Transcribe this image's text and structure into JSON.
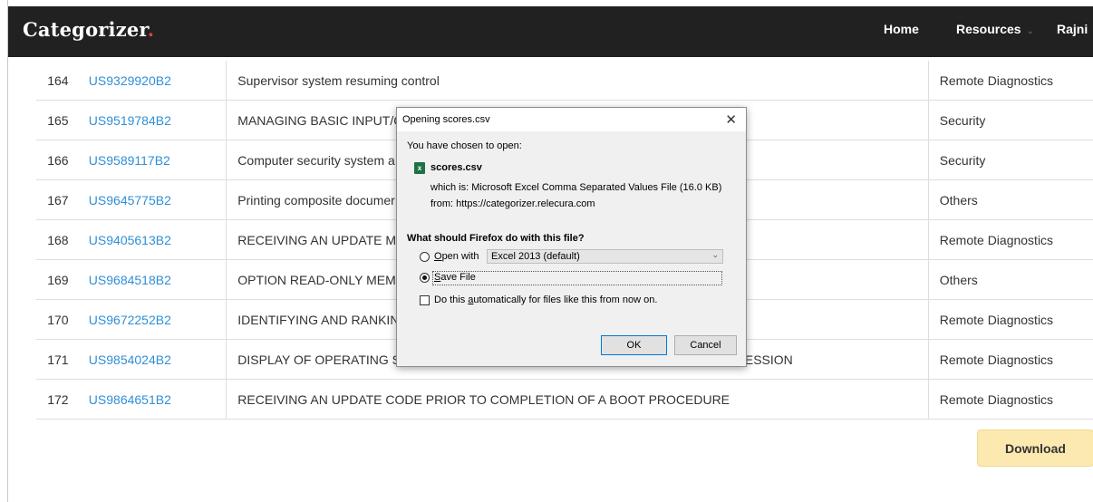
{
  "navbar": {
    "brand": "Categorizer",
    "brand_dot": ".",
    "items": [
      {
        "label": "Home"
      },
      {
        "label": "Resources",
        "caret": "⌄"
      },
      {
        "label": "Rajni"
      }
    ]
  },
  "table": {
    "rows": [
      {
        "num": "164",
        "id": "US9329920B2",
        "title": "Supervisor system resuming control",
        "category": "Remote Diagnostics"
      },
      {
        "num": "165",
        "id": "US9519784B2",
        "title": "MANAGING BASIC INPUT/C",
        "category": "Security"
      },
      {
        "num": "166",
        "id": "US9589117B2",
        "title": "Computer security system a",
        "category": "Security"
      },
      {
        "num": "167",
        "id": "US9645775B2",
        "title": "Printing composite documer",
        "category": "Others"
      },
      {
        "num": "168",
        "id": "US9405613B2",
        "title": "RECEIVING AN UPDATE MC",
        "category": "Remote Diagnostics"
      },
      {
        "num": "169",
        "id": "US9684518B2",
        "title": "OPTION READ-ONLY MEMC",
        "category": "Others"
      },
      {
        "num": "170",
        "id": "US9672252B2",
        "title": "IDENTIFYING AND RANKING",
        "category": "Remote Diagnostics"
      },
      {
        "num": "171",
        "id": "US9854024B2",
        "title": "DISPLAY OF OPERATING ST",
        "title_tail": "P SESSION",
        "category": "Remote Diagnostics"
      },
      {
        "num": "172",
        "id": "US9864651B2",
        "title": "RECEIVING AN UPDATE CODE PRIOR TO COMPLETION OF A BOOT PROCEDURE",
        "category": "Remote Diagnostics"
      }
    ]
  },
  "download_label": "Download",
  "dialog": {
    "title": "Opening scores.csv",
    "close": "✕",
    "intro": "You have chosen to open:",
    "file_icon": "x",
    "file_name": "scores.csv",
    "which_is": "which is:  Microsoft Excel Comma Separated Values File (16.0 KB)",
    "from": "from:  https://categorizer.relecura.com",
    "question": "What should Firefox do with this file?",
    "open_with_u": "O",
    "open_with_rest": "pen with",
    "open_with_value": "Excel 2013 (default)",
    "save_file_u": "S",
    "save_file_rest": "ave File",
    "auto_pre": "Do this ",
    "auto_u": "a",
    "auto_rest": "utomatically for files like this from now on.",
    "ok": "OK",
    "cancel": "Cancel"
  },
  "colors": {
    "navbar": "#212121",
    "brand_dot": "#e0453a",
    "link": "#2f8fd8",
    "download_bg": "#fce9b0"
  }
}
